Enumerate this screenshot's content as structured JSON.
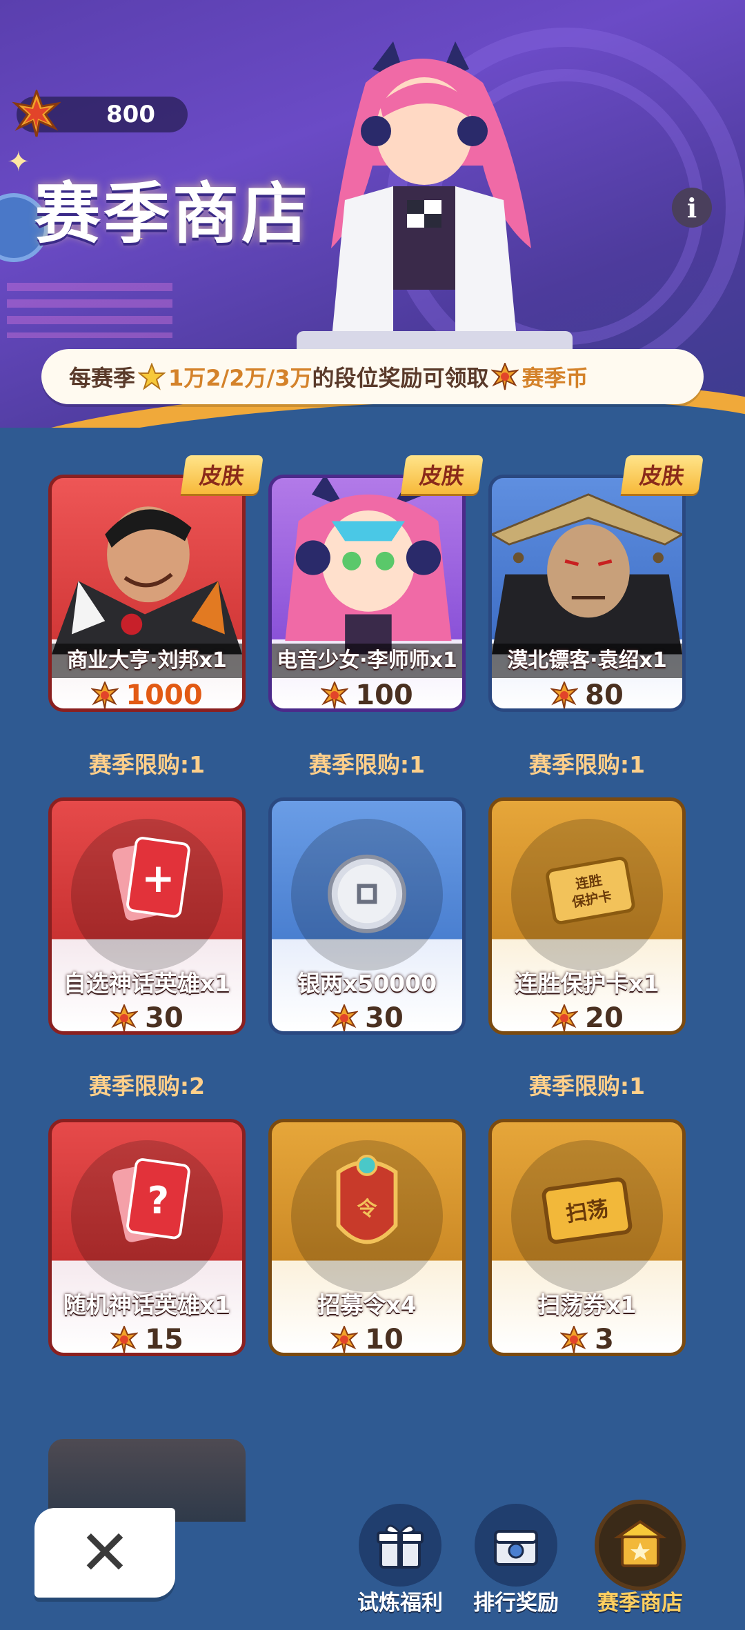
{
  "header": {
    "currency_amount": "800",
    "title": "赛季商店",
    "info_label": "i",
    "banner": {
      "prefix": "每赛季",
      "tiers": "1万2/2万/3万",
      "middle": "的段位奖励可领取",
      "currency_name": "赛季币"
    }
  },
  "skin_tag": "皮肤",
  "items": [
    {
      "name": "商业大亨·刘邦x1",
      "price": "1000",
      "limit": "赛季限购:1",
      "tag": "皮肤"
    },
    {
      "name": "电音少女·李师师x1",
      "price": "100",
      "limit": "赛季限购:1",
      "tag": "皮肤"
    },
    {
      "name": "漠北镖客·袁绍x1",
      "price": "80",
      "limit": "赛季限购:1",
      "tag": "皮肤"
    },
    {
      "name": "自选神话英雄x1",
      "price": "30",
      "limit": "赛季限购:2"
    },
    {
      "name": "银两x50000",
      "price": "30"
    },
    {
      "name": "连胜保护卡x1",
      "price": "20",
      "limit": "赛季限购:1",
      "card_text": "连胜\n保护卡"
    },
    {
      "name": "随机神话英雄x1",
      "price": "15"
    },
    {
      "name": "招募令x4",
      "price": "10"
    },
    {
      "name": "扫荡券x1",
      "price": "3",
      "card_text": "扫荡"
    }
  ],
  "nav": {
    "close_label": "✕",
    "tabs": [
      {
        "label": "试炼福利",
        "icon": "gift-icon"
      },
      {
        "label": "排行奖励",
        "icon": "chest-icon"
      },
      {
        "label": "赛季商店",
        "icon": "shop-icon",
        "active": true
      }
    ]
  },
  "colors": {
    "background": "#2f5a92",
    "price_highlight": "#e25a14",
    "limit_text": "#ffcf8a",
    "active_tab": "#ffd060"
  }
}
